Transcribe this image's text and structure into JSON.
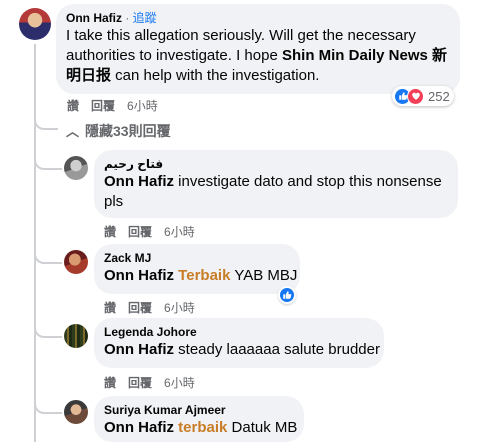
{
  "main_comment": {
    "author": "Onn Hafiz",
    "follow_label": "追蹤",
    "separator": " · ",
    "text_parts": {
      "before": "I take this allegation seriously. Will get the necessary authorities to investigate. I hope ",
      "tag": "Shin Min Daily News 新明日报",
      "after": " can help with the investigation."
    },
    "actions": {
      "like": "讚",
      "reply": "回覆",
      "time": "6小時"
    },
    "reactions": {
      "count": "252",
      "types": [
        "like-icon",
        "love-icon"
      ]
    }
  },
  "hidden_replies_label": "隱藏33則回覆",
  "replies": [
    {
      "author": "فتاح رحيم",
      "mention": "Onn Hafiz",
      "text": " investigate dato and stop this nonsense pls",
      "actions": {
        "like": "讚",
        "reply": "回覆",
        "time": "6小時"
      }
    },
    {
      "author": "Zack MJ",
      "mention": "Onn Hafiz",
      "highlight": "Terbaik",
      "text": " YAB MBJ",
      "actions": {
        "like": "讚",
        "reply": "回覆",
        "time": "6小時"
      }
    },
    {
      "author": "Legenda Johore",
      "mention": "Onn Hafiz",
      "text": " steady laaaaaa salute brudder",
      "actions": {
        "like": "讚",
        "reply": "回覆",
        "time": "6小時"
      }
    },
    {
      "author": "Suriya Kumar Ajmeer",
      "mention": "Onn Hafiz",
      "highlight": "terbaik",
      "text": " Datuk MB"
    }
  ],
  "colors": {
    "bubble": "#f0f2f5",
    "link_blue": "#1877f2",
    "muted": "#65676b",
    "highlight_orange": "#c97d27",
    "love_red": "#f33e58"
  }
}
